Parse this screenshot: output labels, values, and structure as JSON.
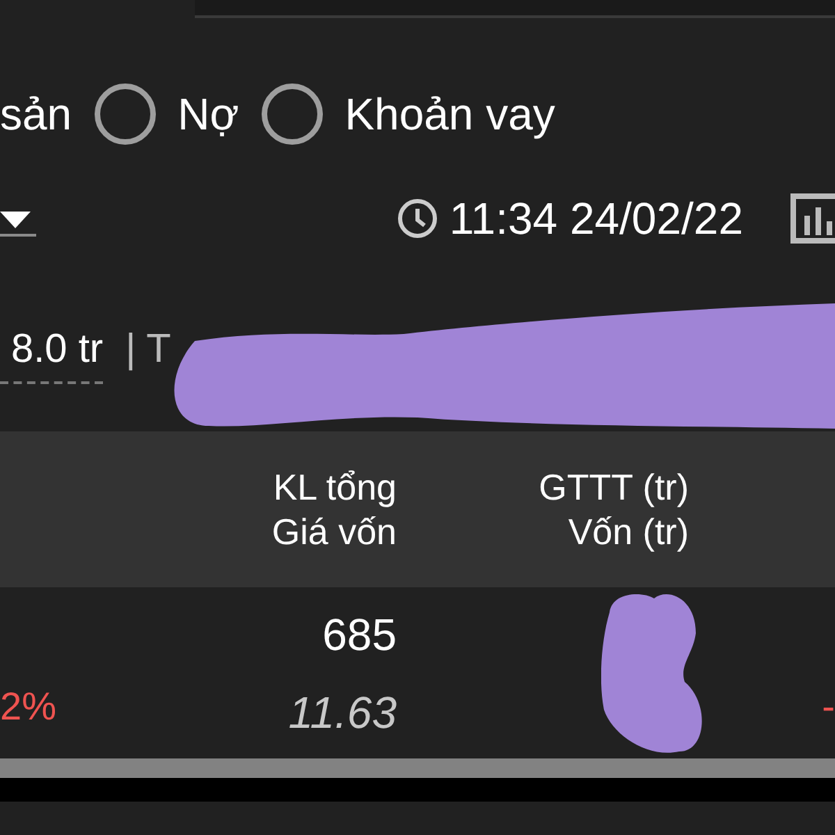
{
  "filter": {
    "cut_label": "sản",
    "options": [
      {
        "label": "Nợ",
        "selected": false
      },
      {
        "label": "Khoản vay",
        "selected": false
      }
    ]
  },
  "toolbar": {
    "timestamp": "11:34 24/02/22"
  },
  "summary": {
    "value": "8.0 tr",
    "separator": "|",
    "cut_label": "T"
  },
  "table": {
    "columns": [
      {
        "line_1": "KL tổng",
        "line_2": "Giá vốn"
      },
      {
        "line_1": "GTTT (tr)",
        "line_2": "Vốn (tr)"
      }
    ],
    "rows": [
      {
        "change": "2%",
        "volume": "685",
        "cost_price": "11.63",
        "trailing": "-"
      }
    ]
  }
}
